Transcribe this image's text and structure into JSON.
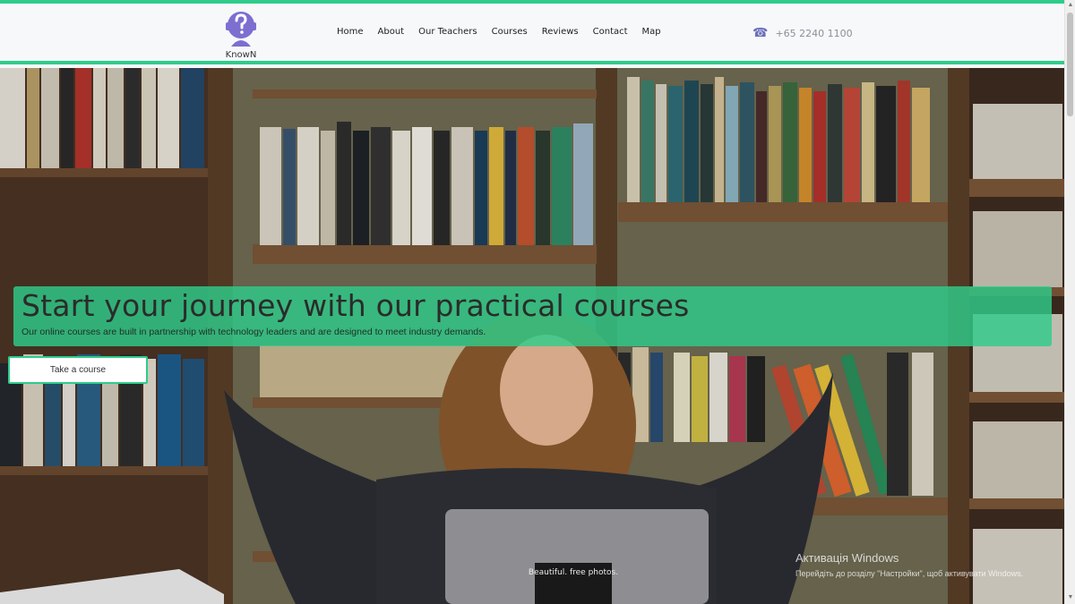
{
  "brand": {
    "name": "KnowN",
    "logo_icon": "question-head-icon",
    "accent": "#2ecc8a",
    "logo_color": "#7b6fd0"
  },
  "nav": {
    "items": [
      "Home",
      "About",
      "Our Teachers",
      "Courses",
      "Reviews",
      "Contact",
      "Map"
    ]
  },
  "contact": {
    "phone_icon": "phone-icon",
    "phone": "+65 2240 1100"
  },
  "hero": {
    "title": "Start your journey with our practical courses",
    "subtitle": "Our online courses are built in partnership with technology leaders and are designed to meet industry demands.",
    "cta_label": "Take a course",
    "laptop_sticker": "Beautiful. free photos."
  },
  "os_watermark": {
    "title": "Активація Windows",
    "subtitle": "Перейдіть до розділу \"Настройки\", щоб активувати Windows."
  }
}
